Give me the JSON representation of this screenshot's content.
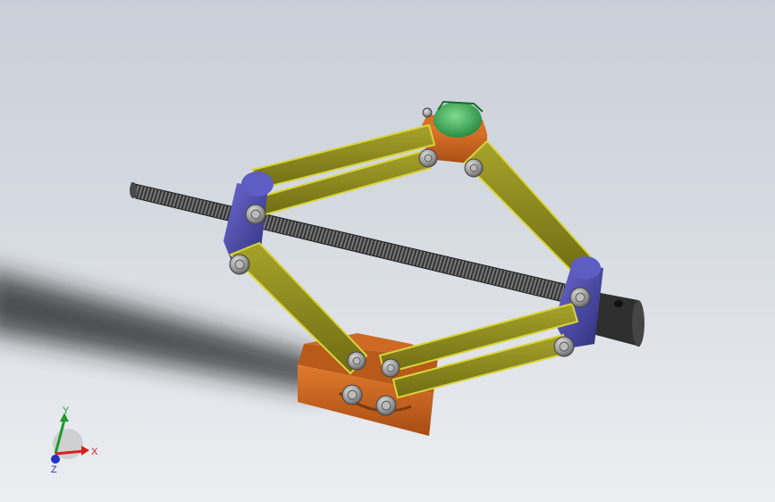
{
  "viewport": {
    "background_top": "#c9cfd8",
    "background_bottom": "#eceef1"
  },
  "model": {
    "parts": [
      {
        "name": "lead-screw",
        "color": "#3a3a3a"
      },
      {
        "name": "scissor-arm",
        "color": "#8c8a1e",
        "count": 4
      },
      {
        "name": "lower-base",
        "color": "#c8621f"
      },
      {
        "name": "top-saddle",
        "color": "#c8621f"
      },
      {
        "name": "saddle-pad",
        "color": "#3fae5a"
      },
      {
        "name": "pivot-block",
        "color": "#4b4a9e",
        "count": 2
      },
      {
        "name": "drive-sleeve",
        "color": "#2a2a2a"
      },
      {
        "name": "hex-bolt",
        "color": "#9a9a9a",
        "count": 9
      }
    ]
  },
  "triad": {
    "x_label": "X",
    "y_label": "Y",
    "z_label": "Z",
    "x_color": "#d42020",
    "y_color": "#1f9a2a",
    "z_color": "#2233c8"
  }
}
